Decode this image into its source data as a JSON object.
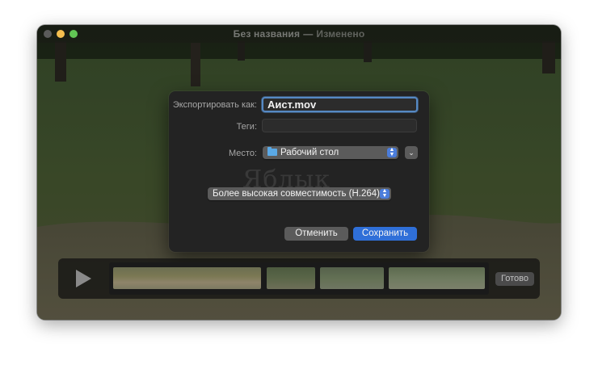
{
  "window": {
    "title": "Без названия",
    "separator": "—",
    "status": "Изменено"
  },
  "export_dialog": {
    "export_as_label": "Экспортировать как:",
    "filename": "Аист.mov",
    "tags_label": "Теги:",
    "tags_value": "",
    "location_label": "Место:",
    "location_value": "Рабочий стол",
    "location_icon": "folder-icon",
    "format_value": "Более высокая совместимость (H.264)",
    "cancel_label": "Отменить",
    "save_label": "Сохранить",
    "expand_icon": "chevron-down-icon"
  },
  "watermark": "Яблык",
  "trim_bar": {
    "play_icon": "play-icon",
    "done_label": "Готово"
  },
  "colors": {
    "accent": "#2f6fd8",
    "focus_ring": "#5689c4",
    "stepper": "#4b7ddb"
  }
}
